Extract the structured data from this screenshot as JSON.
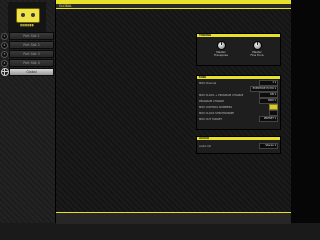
{
  "sidebar": {
    "logo_text": "▮▮▮▮▮▮▮",
    "items": [
      {
        "num": "1",
        "label": "Part Slot 1"
      },
      {
        "num": "2",
        "label": "Part Slot 2"
      },
      {
        "num": "3",
        "label": "Part Slot 3"
      },
      {
        "num": "4",
        "label": "Part Slot 4"
      },
      {
        "num": "",
        "label": "Global"
      }
    ]
  },
  "header": {
    "tab": "GLOBAL"
  },
  "tuning": {
    "title": "TUNING",
    "knobs": [
      {
        "label1": "Master",
        "label2": "Transpose",
        "icon": "knob-icon"
      },
      {
        "label1": "Master",
        "label2": "Fine Tune",
        "icon": "knob-icon"
      }
    ]
  },
  "midi": {
    "title": "MIDI",
    "rows": [
      {
        "label": "MIDI Channel",
        "value": "1 ▾"
      },
      {
        "label": "",
        "value": "EVENTIDE ECHO ▾"
      },
      {
        "label": "MIDI CLOCK + PROGRAM CHANGE",
        "value": "ON ▾"
      },
      {
        "label": "PROGRAM CHANGE",
        "value": "MIDI ▾"
      },
      {
        "label": "MIDI CONTROL NUMBERS",
        "value": "ON"
      },
      {
        "label": "MIDI CLOCK SYNCHRONIZE",
        "value": "ON"
      },
      {
        "label": "MIDI OUT TARGET",
        "value": "PRESET ▾"
      }
    ]
  },
  "audio": {
    "title": "AUDIO",
    "rows": [
      {
        "label": "Audio I/O",
        "value": "Stereo ▾"
      }
    ]
  },
  "colors": {
    "accent": "#e9e02a",
    "background": "#1a1a1a"
  }
}
